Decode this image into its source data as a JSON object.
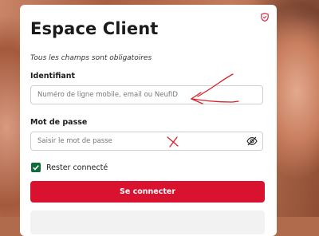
{
  "card": {
    "title": "Espace Client",
    "required_note": "Tous les champs sont obligatoires"
  },
  "identifier": {
    "label": "Identifiant",
    "placeholder": "Numéro de ligne mobile, email ou NeufID",
    "value": ""
  },
  "password": {
    "label": "Mot de passe",
    "placeholder": "Saisir le mot de passe",
    "value": ""
  },
  "remember": {
    "label": "Rester connecté",
    "checked": true
  },
  "submit": {
    "label": "Se connecter"
  },
  "icons": {
    "shield": "shield-icon",
    "eye": "eye-slash-icon",
    "check": "checkmark-icon"
  },
  "colors": {
    "brand_red": "#d9122f",
    "checkbox_green": "#0f6b3a",
    "annotation_red": "#d6202a"
  }
}
